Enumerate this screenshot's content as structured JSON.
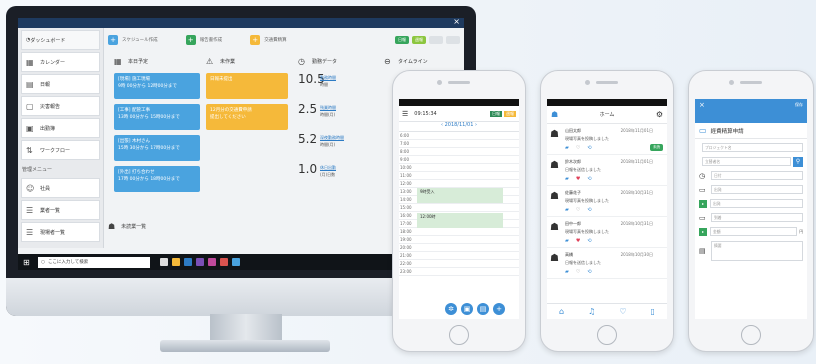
{
  "colors": {
    "accent_blue": "#3d8fd6",
    "card_blue": "#4aa3df",
    "card_orange": "#f5b93a",
    "green": "#36a55c",
    "navy": "#1e3a5f"
  },
  "desktop": {
    "sidebar": {
      "dashboard": "ダッシュボード",
      "items": [
        {
          "icon": "calendar-icon",
          "label": "カレンダー"
        },
        {
          "icon": "note-icon",
          "label": "日報"
        },
        {
          "icon": "chat-icon",
          "label": "災害報告"
        },
        {
          "icon": "document-icon",
          "label": "出勤簿"
        },
        {
          "icon": "workflow-icon",
          "label": "ワークフロー"
        }
      ],
      "section_title": "管理メニュー",
      "section_items": [
        {
          "icon": "person-icon",
          "label": "社員"
        },
        {
          "icon": "list-icon",
          "label": "業者一覧"
        },
        {
          "icon": "list-icon",
          "label": "現場者一覧"
        },
        {
          "icon": "list-icon",
          "label": "工事業一覧"
        }
      ]
    },
    "top_chips": [
      {
        "icon": "+",
        "label": "スケジュール作成",
        "color": "#4aa3df"
      },
      {
        "icon": "+",
        "label": "報告書作成",
        "color": "#36a55c"
      },
      {
        "icon": "+",
        "label": "交通費精算",
        "color": "#f5b93a"
      }
    ],
    "top_buttons": [
      "日報",
      "週報"
    ],
    "schedule": {
      "title": "本日予定",
      "cards": [
        {
          "title": "[現場] 施工現場",
          "time": "9時 00分から 12時00分まで"
        },
        {
          "title": "[工事] 配管工事",
          "time": "13時 00分から 15時00分まで"
        },
        {
          "title": "[出張] 木村さん",
          "time": "15時 30分から 17時00分まで"
        },
        {
          "title": "[外出] 打ち合わせ",
          "time": "17時 00分から 18時00分まで"
        }
      ]
    },
    "todo": {
      "title": "未作業",
      "cards": [
        {
          "line1": "日報未提出",
          "line2": ""
        },
        {
          "line1": "12月分の交通費申請",
          "line2": "提出してください"
        }
      ]
    },
    "stats": {
      "title": "勤務データ",
      "rows": [
        {
          "num": "10.5",
          "unit": "時間",
          "link": "勤務時間"
        },
        {
          "num": "2.5",
          "unit": "時間(月)",
          "link": "残業時間"
        },
        {
          "num": "5.2",
          "unit": "時間(月)",
          "link": "深夜勤務時間"
        },
        {
          "num": "1.0",
          "unit": "(月)日数",
          "link": "休日出勤"
        }
      ]
    },
    "timeline": {
      "title": "タイムライン"
    },
    "bottom": {
      "label": "未読業一覧"
    },
    "taskbar": {
      "search_placeholder": "ここに入力して検索"
    }
  },
  "phone1": {
    "time": "09:15:34",
    "btn1": "日報",
    "btn2": "週報",
    "date": "2018/11/01",
    "hours": [
      "6:00",
      "7:00",
      "8:00",
      "9:00",
      "10:00",
      "11:00",
      "12:00",
      "13:00",
      "14:00",
      "15:00",
      "16:00",
      "17:00",
      "18:00",
      "19:00",
      "20:00",
      "21:00",
      "22:00",
      "23:00"
    ],
    "events": [
      {
        "label": "9時受入"
      },
      {
        "label": "12:00時"
      }
    ]
  },
  "phone2": {
    "title": "ホーム",
    "messages": [
      {
        "name": "山田太郎",
        "date": "2018年11月01日",
        "text": "現場写真を投稿しました",
        "badge": "未読",
        "badge_color": "#36a55c"
      },
      {
        "name": "鈴木次郎",
        "date": "2018年11月01日",
        "text": "日報を送信しました",
        "badge": "",
        "badge_color": ""
      },
      {
        "name": "佐藤花子",
        "date": "2018年10月31日",
        "text": "現場写真を投稿しました",
        "badge": "",
        "badge_color": ""
      },
      {
        "name": "田中一郎",
        "date": "2018年10月31日",
        "text": "現場写真を投稿しました",
        "badge": "",
        "badge_color": ""
      },
      {
        "name": "高橋",
        "date": "2018年10月30日",
        "text": "日報を送信しました",
        "badge": "",
        "badge_color": ""
      }
    ]
  },
  "phone3": {
    "save": "保存",
    "title": "経費精算申請",
    "fields": [
      {
        "label": "プロジェクト名",
        "value": ""
      },
      {
        "label": "",
        "value": "立替者名"
      },
      {
        "label": "",
        "value": "日付"
      },
      {
        "label": "出発",
        "value": ""
      },
      {
        "label": "出発",
        "value": ""
      },
      {
        "label": "到着",
        "value": ""
      },
      {
        "label": "金額",
        "value": "円"
      },
      {
        "label": "摘要",
        "value": ""
      }
    ]
  }
}
